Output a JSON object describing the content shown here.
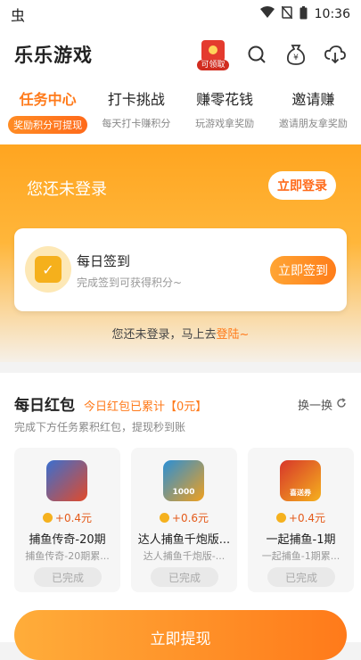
{
  "statusbar": {
    "time": "10:36",
    "bug_icon": "虫"
  },
  "appbar": {
    "title": "乐乐游戏",
    "redpack_badge": "可领取"
  },
  "tabs": [
    {
      "name": "任务中心",
      "sub": "奖励积分可提现",
      "active": true
    },
    {
      "name": "打卡挑战",
      "sub": "每天打卡赚积分",
      "active": false
    },
    {
      "name": "赚零花钱",
      "sub": "玩游戏拿奖励",
      "active": false
    },
    {
      "name": "邀请赚",
      "sub": "邀请朋友拿奖励",
      "active": false
    }
  ],
  "hero": {
    "login_text": "您还未登录",
    "login_button": "立即登录",
    "sign_title": "每日签到",
    "sign_sub": "完成签到可获得积分~",
    "sign_button": "立即签到",
    "notice_prefix": "您还未登录，马上去",
    "notice_link": "登陆~"
  },
  "daily": {
    "title": "每日红包",
    "summary": "今日红包已累计【0元】",
    "refresh": "换一换",
    "desc": "完成下方任务累积红包，提现秒到账",
    "cards": [
      {
        "reward": "+0.4元",
        "name": "捕鱼传奇-20期",
        "sub": "捕鱼传奇-20期累...",
        "status": "已完成",
        "icon": "fish-game-icon",
        "color": "#3a6fd0"
      },
      {
        "reward": "+0.6元",
        "name": "达人捕鱼千炮版...",
        "sub": "达人捕鱼千炮版-...",
        "status": "已完成",
        "icon": "fish-cannon-icon",
        "color": "#2a8fd6",
        "badge": "1000"
      },
      {
        "reward": "+0.4元",
        "name": "一起捕鱼-1期",
        "sub": "一起捕鱼-1期累...",
        "status": "已完成",
        "icon": "gold-fish-icon",
        "color": "#d7362a",
        "badge": "喜送券"
      }
    ],
    "withdraw_button": "立即提现"
  }
}
